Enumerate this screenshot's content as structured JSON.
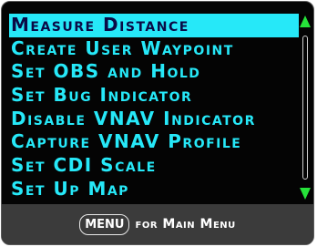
{
  "menu": {
    "items": [
      {
        "label": "Measure Distance",
        "selected": true
      },
      {
        "label": "Create User Waypoint",
        "selected": false
      },
      {
        "label": "Set OBS and Hold",
        "selected": false
      },
      {
        "label": "Set Bug Indicator",
        "selected": false
      },
      {
        "label": "Disable VNAV Indicator",
        "selected": false
      },
      {
        "label": "Capture VNAV Profile",
        "selected": false
      },
      {
        "label": "Set CDI Scale",
        "selected": false
      },
      {
        "label": "Set Up Map",
        "selected": false
      }
    ]
  },
  "scrollbar": {
    "up_icon": "arrow-up-icon",
    "down_icon": "arrow-down-icon"
  },
  "footer": {
    "key_label": "MENU",
    "text": "for Main Menu"
  },
  "colors": {
    "text": "#26e8f8",
    "selected_bg": "#26e8f8",
    "selected_text": "#0a0a46",
    "arrows": "#26e43a",
    "background": "#040404",
    "footer_bg": "#3b3b3b"
  }
}
